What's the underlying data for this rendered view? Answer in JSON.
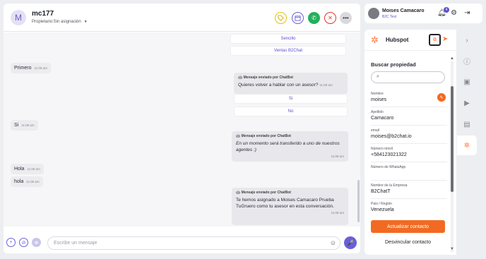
{
  "header": {
    "avatar_letter": "M",
    "contact_name": "mc177",
    "owner_label": "Propietario:Sin asignación",
    "actions": [
      "tag-icon",
      "calendar-icon",
      "whatsapp-icon",
      "close-icon",
      "more-icon"
    ]
  },
  "messages": {
    "top_options": [
      "Sencillo",
      "Ventas B2Chat"
    ],
    "in_1": {
      "text": "Primero",
      "time": "11:08 am"
    },
    "out_1": {
      "label": "Mensaje enviado por ChatBot",
      "text": "Quieres volver a hablar con un asesor?",
      "time": "11:08 am"
    },
    "options_1": [
      "Si",
      "No"
    ],
    "in_2": {
      "text": "Si",
      "time": "11:08 am"
    },
    "out_2": {
      "label": "Mensaje enviado por ChatBot",
      "text": "En un momento será transferido a uno de nuestros agentes :)",
      "time": "11:08 am"
    },
    "in_3": {
      "text": "Hola",
      "time": "11:08 am"
    },
    "in_4": {
      "text": "hola",
      "time": "11:08 am"
    },
    "out_3": {
      "label": "Mensaje enviado por ChatBot",
      "text": "Te hemos asignado a Moises Camacaro Prueba TuGruero como tu asesor en esta conversación.",
      "time": "11:08 am"
    }
  },
  "composer": {
    "placeholder": "Escribe un mensaje"
  },
  "topbar": {
    "user_name": "Moises Camacaro",
    "org": "B2C Test",
    "notif_count": "4"
  },
  "hubspot": {
    "title": "Hubspot",
    "search_label": "Buscar propiedad",
    "fields": [
      {
        "label": "Nombre",
        "value": "moises"
      },
      {
        "label": "Apellido",
        "value": "Camacaro"
      },
      {
        "label": "email",
        "value": "moises@b2chat.io"
      },
      {
        "label": "Número móvil",
        "value": "+584123021322"
      },
      {
        "label": "Número de WhatsApp",
        "value": ""
      },
      {
        "label": "Nombre de la Empresa",
        "value": "B2ChatT"
      },
      {
        "label": "País / Región",
        "value": "Venezuela"
      }
    ],
    "update_button": "Actualizar contacto",
    "unlink_button": "Desvincular contacto"
  },
  "colors": {
    "accent": "#6b5fd8",
    "hubspot_orange": "#f26a21"
  }
}
